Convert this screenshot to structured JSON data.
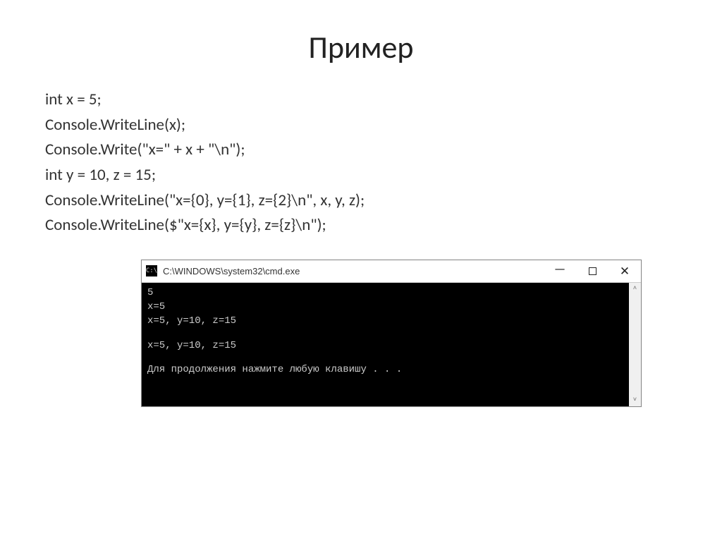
{
  "title": "Пример",
  "code": {
    "l1": "int x = 5;",
    "l2": "Console.WriteLine(x);",
    "l3": "Console.Write(\"x=\" + x + \"\\n\");",
    "l4": "int y = 10, z = 15;",
    "l5": "Console.WriteLine(\"x={0}, y={1}, z={2}\\n\", x, y, z);",
    "l6": "Console.WriteLine($\"x={x}, y={y}, z={z}\\n\");"
  },
  "cmd": {
    "icon_label": "C:\\",
    "title": "C:\\WINDOWS\\system32\\cmd.exe",
    "output": {
      "l1": "5",
      "l2": "x=5",
      "l3": "x=5, y=10, z=15",
      "l4": "x=5, y=10, z=15",
      "l5": "Для продолжения нажмите любую клавишу . . ."
    }
  },
  "chart_data": {
    "type": "table",
    "title": "Console output example",
    "variables": {
      "x": 5,
      "y": 10,
      "z": 15
    },
    "output_lines": [
      "5",
      "x=5",
      "x=5, y=10, z=15",
      "",
      "x=5, y=10, z=15",
      "",
      "Для продолжения нажмите любую клавишу . . ."
    ]
  }
}
